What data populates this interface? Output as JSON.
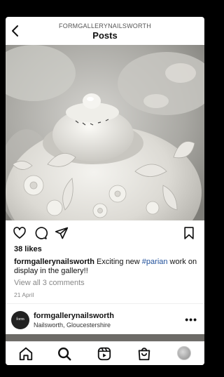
{
  "header": {
    "username": "FORMGALLERYNAILSWORTH",
    "title": "Posts"
  },
  "post": {
    "likes": "38 likes",
    "caption_user": "formgallerynailsworth",
    "caption_text_1": "Exciting new ",
    "caption_hashtag": "#parian",
    "caption_text_2": " work on display in the gallery!!",
    "comments_link": "View all 3 comments",
    "date": "21 April",
    "image_alt": "parian porcelain jar"
  },
  "next_post": {
    "username": "formgallerynailsworth",
    "location": "Nailsworth, Gloucestershire",
    "avatar_text": "form",
    "more_label": "•••"
  },
  "icons": {
    "back": "chevron-left-icon",
    "like": "heart-icon",
    "comment": "comment-icon",
    "share": "send-icon",
    "save": "bookmark-icon",
    "home": "home-icon",
    "search": "search-icon",
    "reels": "reels-icon",
    "shop": "shop-bag-icon",
    "profile": "profile-avatar"
  }
}
